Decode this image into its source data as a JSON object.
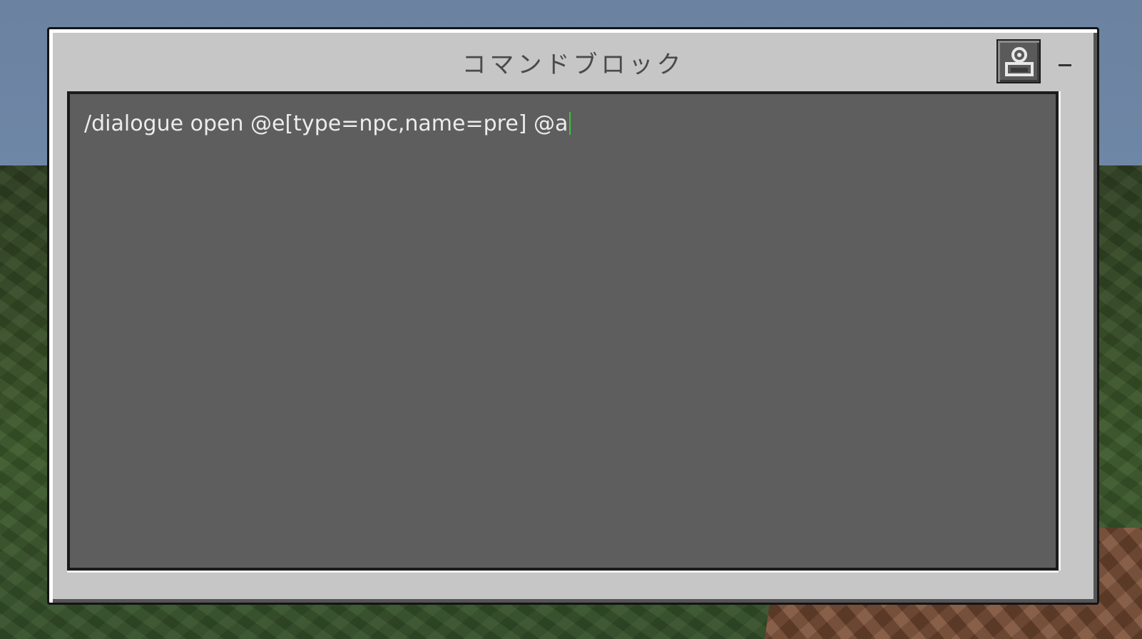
{
  "window": {
    "title": "コマンドブロック"
  },
  "toolbar": {
    "settings_icon": "command-block-mode-icon",
    "minimize_icon": "minimize-icon"
  },
  "command": {
    "value": "/dialogue open @e[type=npc,name=pre] @a"
  },
  "colors": {
    "panel": "#c6c6c6",
    "input_bg": "#5e5e5e",
    "caret": "#3ac53a"
  }
}
